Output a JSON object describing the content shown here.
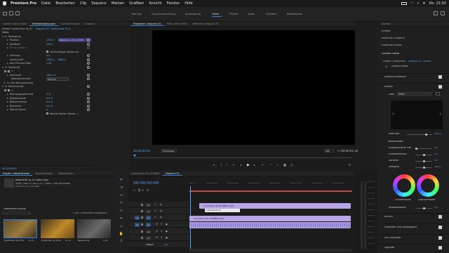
{
  "menubar": {
    "app": "Premiere Pro",
    "items": [
      "Datei",
      "Bearbeiten",
      "Clip",
      "Sequenz",
      "Marken",
      "Grafiken",
      "Ansicht",
      "Fenster",
      "Hilfe"
    ],
    "clock": "Do. 21:02"
  },
  "workspaces": [
    "Training",
    "Zusammenstellung",
    "Bearbeitung",
    "Farbe",
    "Effekte",
    "Audio",
    "Grafiken",
    "Bibliotheken"
  ],
  "workspace_active": "Farbe",
  "source_panel": {
    "tabs": [
      "Quelle: (keine Clips)",
      "Effekteinstellungen",
      "Lumetri-Scopes",
      "Audioclip-Mix"
    ],
    "master": "Master * production ID_477085...",
    "sequence": "Sequenz 01 * production ID_4...",
    "clip_bar": "production ID_477085",
    "section": "Video",
    "rows": [
      {
        "label": "Bewegung",
        "kind": "group"
      },
      {
        "label": "Position",
        "v1": "1920,0",
        "v2": "1080,0"
      },
      {
        "label": "Skalieren",
        "v1": "100,0"
      },
      {
        "label": "Breite skalieren",
        "v1": "",
        "dim": true
      },
      {
        "label": "Gleichmäßige Skalierung",
        "kind": "checkbox"
      },
      {
        "label": "Drehung",
        "v1": "0,0"
      },
      {
        "label": "Ankerpunkt",
        "v1": "1920,0",
        "v2": "1080,0"
      },
      {
        "label": "Anti-Flimmer-Filter",
        "v1": "0,00"
      },
      {
        "label": "Deckkraft",
        "kind": "group"
      },
      {
        "label": "Deckkraft",
        "v1": "100,0 %"
      },
      {
        "label": "Überblendmodus",
        "select": "Normal"
      },
      {
        "label": "Zeit-Neuzuordnung",
        "kind": "group"
      },
      {
        "label": "Bildzuschnitt",
        "kind": "group"
      },
      {
        "label": "Übergangsabschnitt",
        "v1": "0 %"
      },
      {
        "label": "Bildoberkante",
        "v1": "0,0 %"
      },
      {
        "label": "Bildunterkante",
        "v1": "0,0 %"
      },
      {
        "label": "Bildrechts",
        "v1": "0,0 %"
      },
      {
        "label": "Weiche Kante",
        "v1": "0"
      },
      {
        "label": "Weiche Kanten (Beide...)",
        "kind": "checkbox"
      }
    ],
    "timecode": "00:00:00:00"
  },
  "program": {
    "tabs": [
      "Programm: Sequenz 01",
      "Titel: (ohne Titel)",
      "Referenz: Sequenz 01"
    ],
    "timecode": "00:00:00:03",
    "fit": "Einpassen",
    "quality": "Voll",
    "duration": "00:00:01:19"
  },
  "project": {
    "tabs": [
      "Projekt: videoEditieren",
      "Media-Browser",
      "Bibliotheken"
    ],
    "clip_name": "production ID_4770865.mp4",
    "clip_info": "Video, 3840 x 2160 (1,0) • Video 1 Mal verwendet",
    "clip_fps": "00:00:11:13, 24,000p",
    "file": "videoEditiert.prproj",
    "count": "1 von 5 Elementen ausgewählt",
    "thumbs": [
      {
        "name": "production ID_4770...",
        "dur": "11:13",
        "color": "#7a5a2a"
      },
      {
        "name": "production ID_4770...",
        "dur": "11:13",
        "color": "#9a6a1e"
      },
      {
        "name": "Sequenz 01",
        "dur": "1:19",
        "color": "#4a4a4a"
      }
    ]
  },
  "timeline": {
    "tabs": [
      "production ID_4770865",
      "Sequenz 01"
    ],
    "timecode": "00:00:00:00",
    "ruler": [
      ":00:00",
      "00:00:00:06",
      "00:00:00:12",
      "00:00:00:18",
      "00:00:01:00",
      "00:00:01:06",
      "00:00:01:12",
      "00:00:01:18"
    ],
    "tracks": [
      "V3",
      "V2",
      "V1",
      "A1",
      "A2",
      "A3"
    ],
    "master": "Master",
    "master_val": "0,0",
    "clip_v2": "production ID_4770865.mp4",
    "clip_v1": "production ID_4770865.mp4",
    "clip_a1": "production ID_4770865.mp4",
    "tooltip": "+00:00:00:07"
  },
  "lumetri": {
    "top_items": [
      "Lernen",
      "Effekte",
      "Essential Graphics",
      "Essential Sound"
    ],
    "header": "Lumetri-Farbe",
    "master": "Master * production...",
    "sequence": "Sequenz 01 * produ...",
    "fx_label": "Lumetri-Farbe",
    "sections": {
      "basic": "Einfache Korrektur",
      "creative": "Kreativ",
      "look": "Look",
      "look_val": "Ohne",
      "intensity": "Intensität",
      "intensity_val": "100,0",
      "adjust": "Anpassungen",
      "faded": "Ausgeblichener Film",
      "faded_val": "0,0",
      "sharpen": "Schärfezeichner",
      "sharpen_val": "0,0",
      "vibrance": "Dynamik",
      "vibrance_val": "0,0",
      "saturation": "Sättigung",
      "saturation_val": "100,0",
      "shadow_tint": "Schattenfarbe",
      "highlight_tint": "Glanzlichtfarbe",
      "tint_balance": "Farbtonbalance",
      "tint_balance_val": "0,0",
      "curves": "Kurven",
      "wheels": "Farbräder und Farbabgleich",
      "hsl": "HSL-Sekundär",
      "vignette": "Vignette"
    }
  },
  "colors": {
    "accent": "#2c7fe2",
    "value_blue": "#5aa9f3",
    "clip_purple": "#b7a4e6",
    "clip_audio": "#a89be0",
    "playhead_red": "#d83b3b"
  }
}
